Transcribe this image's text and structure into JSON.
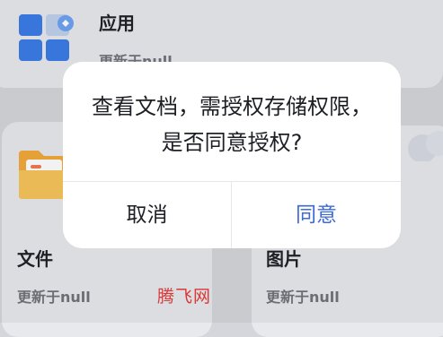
{
  "cards": {
    "apps": {
      "title": "应用",
      "subtitle": "更新于null"
    },
    "files": {
      "title": "文件",
      "subtitle": "更新于null"
    },
    "images": {
      "title": "图片",
      "subtitle": "更新于null"
    }
  },
  "dialog": {
    "message": "查看文档，需授权存储权限，是否同意授权?",
    "cancel_label": "取消",
    "agree_label": "同意"
  },
  "watermark": "腾飞网",
  "colors": {
    "accent": "#3d6ad6",
    "watermark": "#e63a3a",
    "background": "#d4d6db",
    "card": "#e8e9ec"
  },
  "icons": {
    "apps": "app-grid-icon",
    "files": "folder-icon",
    "images": "image-icon"
  }
}
